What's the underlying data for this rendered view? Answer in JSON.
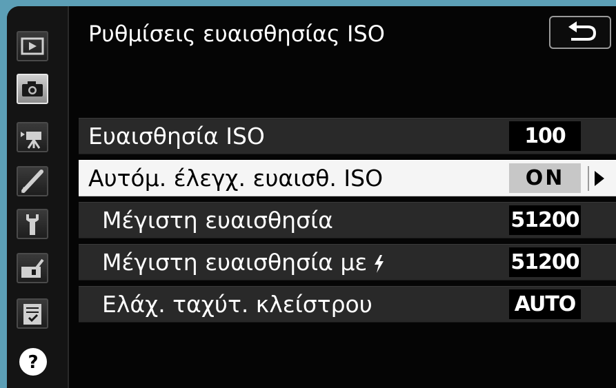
{
  "header": {
    "title": "Ρυθμίσεις ευαισθησίας ISO"
  },
  "sidebar": {
    "items": [
      {
        "icon": "playback-icon",
        "active": false
      },
      {
        "icon": "camera-icon",
        "active": true
      },
      {
        "icon": "movie-camera-icon",
        "active": false
      },
      {
        "icon": "pencil-icon",
        "active": false
      },
      {
        "icon": "wrench-icon",
        "active": false
      },
      {
        "icon": "retouch-icon",
        "active": false
      },
      {
        "icon": "recent-settings-icon",
        "active": false
      },
      {
        "icon": "help-icon",
        "active": false
      }
    ]
  },
  "menu": {
    "items": [
      {
        "label": "Ευαισθησία ISO",
        "value": "100"
      },
      {
        "label": "Αυτόμ. έλεγχ. ευαισθ. ISO",
        "value": "ON",
        "selected": true
      },
      {
        "label": "Μέγιστη ευαισθησία",
        "value": "51200"
      },
      {
        "label": "Μέγιστη ευαισθησία με",
        "value": "51200",
        "icon": "flash-icon"
      },
      {
        "label": "Ελάχ. ταχύτ. κλείστρου",
        "value": "AUTO"
      }
    ]
  },
  "colors": {
    "background": "#5c9fb6",
    "screen": "#050505",
    "row": "#292929",
    "row_selected": "#f5f5f5"
  }
}
